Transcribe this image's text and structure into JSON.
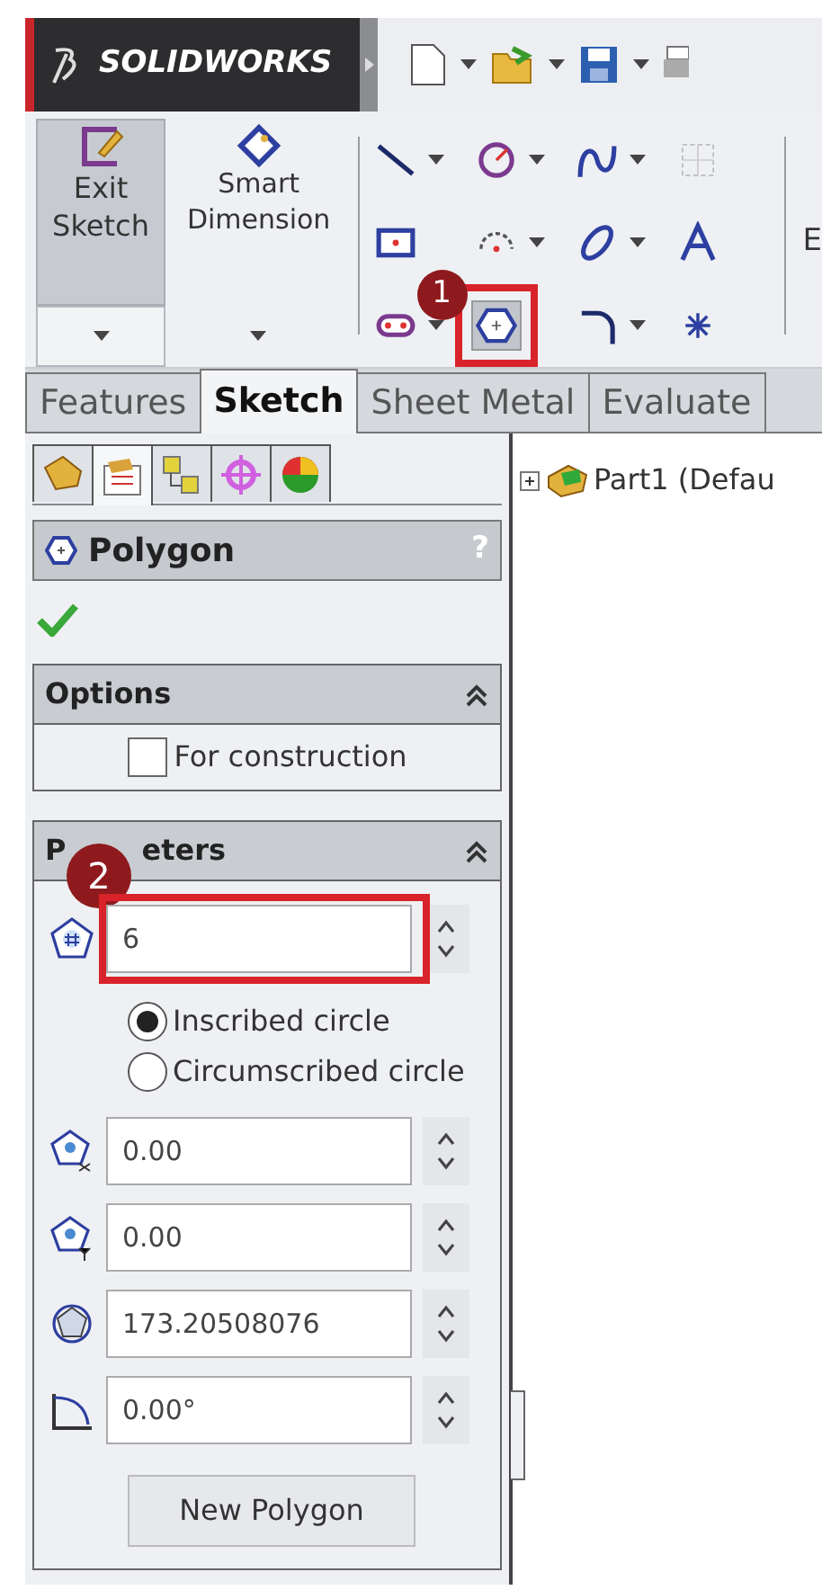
{
  "app": {
    "logo": "SOLIDWORKS"
  },
  "quick_access": [
    {
      "dropdown": true
    },
    {
      "dropdown": true
    },
    {
      "dropdown": true
    },
    {
      "dropdown": false
    }
  ],
  "ribbon": {
    "commands": [
      {
        "label": "Exit Sketch",
        "selected": true,
        "dropdown": true
      },
      {
        "label": "Smart Dimension",
        "selected": false,
        "dropdown": true
      }
    ],
    "tools": [
      {
        "dropdown": true,
        "selected": false
      },
      {
        "dropdown": true,
        "selected": false
      },
      {
        "dropdown": true,
        "selected": false
      },
      {
        "dropdown": false,
        "selected": false
      },
      {
        "dropdown": false,
        "selected": false
      },
      {
        "dropdown": true,
        "selected": false
      },
      {
        "dropdown": true,
        "selected": false
      },
      {
        "dropdown": false,
        "selected": false
      },
      {
        "dropdown": true,
        "selected": false
      },
      {
        "dropdown": false,
        "selected": true
      },
      {
        "dropdown": true,
        "selected": false
      },
      {
        "dropdown": false,
        "selected": false
      }
    ],
    "cut_label": "E"
  },
  "tabs": [
    {
      "label": "Features",
      "selected": false
    },
    {
      "label": "Sketch",
      "selected": true
    },
    {
      "label": "Sheet Metal",
      "selected": false
    },
    {
      "label": "Evaluate",
      "selected": false
    }
  ],
  "property_tabs": [
    {
      "selected": false
    },
    {
      "selected": true
    },
    {
      "selected": false
    },
    {
      "selected": false
    },
    {
      "selected": false
    }
  ],
  "panel": {
    "title": "Polygon",
    "help": "?",
    "options": {
      "title": "Options",
      "expanded": true,
      "checkbox": {
        "label": "For construction",
        "checked": false
      }
    },
    "parameters": {
      "title_parts": [
        "P",
        "eters"
      ],
      "expanded": true,
      "sides": "6",
      "radios": [
        {
          "label": "Inscribed circle",
          "selected": true
        },
        {
          "label": "Circumscribed circle",
          "selected": false
        }
      ],
      "fields": [
        "0.00",
        "0.00",
        "173.20508076",
        "0.00°"
      ],
      "button": "New Polygon"
    }
  },
  "tree": {
    "label": "Part1  (Defau",
    "expanded": false
  },
  "annotations": [
    {
      "number": "1"
    },
    {
      "number": "2"
    }
  ]
}
